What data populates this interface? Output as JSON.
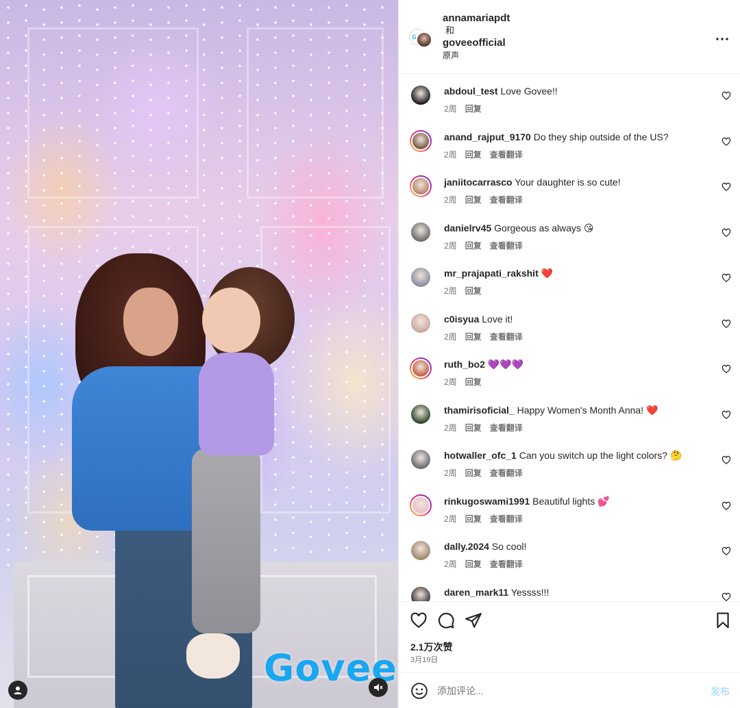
{
  "media": {
    "brand_watermark": "Govee",
    "account_icon": "user-icon",
    "mute_icon": "speaker-muted-icon"
  },
  "header": {
    "author_primary": "annamariapdt",
    "connector": "和",
    "author_secondary": "goveeofficial",
    "audio": "原声",
    "more_icon": "more-horizontal-icon"
  },
  "comments": [
    {
      "user": "abdoul_test",
      "text": "Love Govee!!",
      "time": "2周",
      "reply": "回复",
      "translate": "",
      "ring": false,
      "avatar_color": "#1c1c22"
    },
    {
      "user": "anand_rajput_9170",
      "text": "Do they ship outside of the US?",
      "time": "2周",
      "reply": "回复",
      "translate": "查看翻译",
      "ring": true,
      "avatar_color": "#7a5a44"
    },
    {
      "user": "janiitocarrasco",
      "text": "Your daughter is so cute!",
      "time": "2周",
      "reply": "回复",
      "translate": "查看翻译",
      "ring": true,
      "avatar_color": "#b3866b"
    },
    {
      "user": "danielrv45",
      "text": "Gorgeous as always 😘",
      "time": "2周",
      "reply": "回复",
      "translate": "查看翻译",
      "ring": false,
      "avatar_color": "#6d6d6d"
    },
    {
      "user": "mr_prajapati_rakshit",
      "text": "❤️",
      "time": "2周",
      "reply": "回复",
      "translate": "",
      "ring": false,
      "avatar_color": "#8a8fa0"
    },
    {
      "user": "c0isyua",
      "text": "Love it!",
      "time": "2周",
      "reply": "回复",
      "translate": "查看翻译",
      "ring": false,
      "avatar_color": "#c9a9a0"
    },
    {
      "user": "ruth_bo2",
      "text": "💜💜💜",
      "time": "2周",
      "reply": "回复",
      "translate": "",
      "ring": true,
      "avatar_color": "#c0644a"
    },
    {
      "user": "thamirisoficial_",
      "text": "Happy Women's Month Anna! ❤️",
      "time": "2周",
      "reply": "回复",
      "translate": "查看翻译",
      "ring": false,
      "avatar_color": "#2e4a2e"
    },
    {
      "user": "hotwaller_ofc_1",
      "text": "Can you switch up the light colors? 🤔",
      "time": "2周",
      "reply": "回复",
      "translate": "查看翻译",
      "ring": false,
      "avatar_color": "#6a6d75"
    },
    {
      "user": "rinkugoswami1991",
      "text": "Beautiful lights 💕",
      "time": "2周",
      "reply": "回复",
      "translate": "查看翻译",
      "ring": true,
      "avatar_color": "#e9c2c8"
    },
    {
      "user": "dally.2024",
      "text": "So cool!",
      "time": "2周",
      "reply": "回复",
      "translate": "查看翻译",
      "ring": false,
      "avatar_color": "#a08a6e"
    },
    {
      "user": "daren_mark11",
      "text": "Yessss!!!",
      "time": "",
      "reply": "",
      "translate": "",
      "ring": false,
      "avatar_color": "#3a3a3a"
    }
  ],
  "actions": {
    "like_icon": "heart-icon",
    "comment_icon": "comment-bubble-icon",
    "share_icon": "paper-plane-icon",
    "save_icon": "bookmark-icon",
    "likes": "2.1万次赞",
    "date": "3月19日"
  },
  "composer": {
    "emoji_icon": "emoji-icon",
    "placeholder": "添加评论...",
    "post_label": "发布"
  },
  "colors": {
    "link_blue_disabled": "#b2dffc",
    "secondary_text": "#737373",
    "brand": "#1aa7f2"
  }
}
